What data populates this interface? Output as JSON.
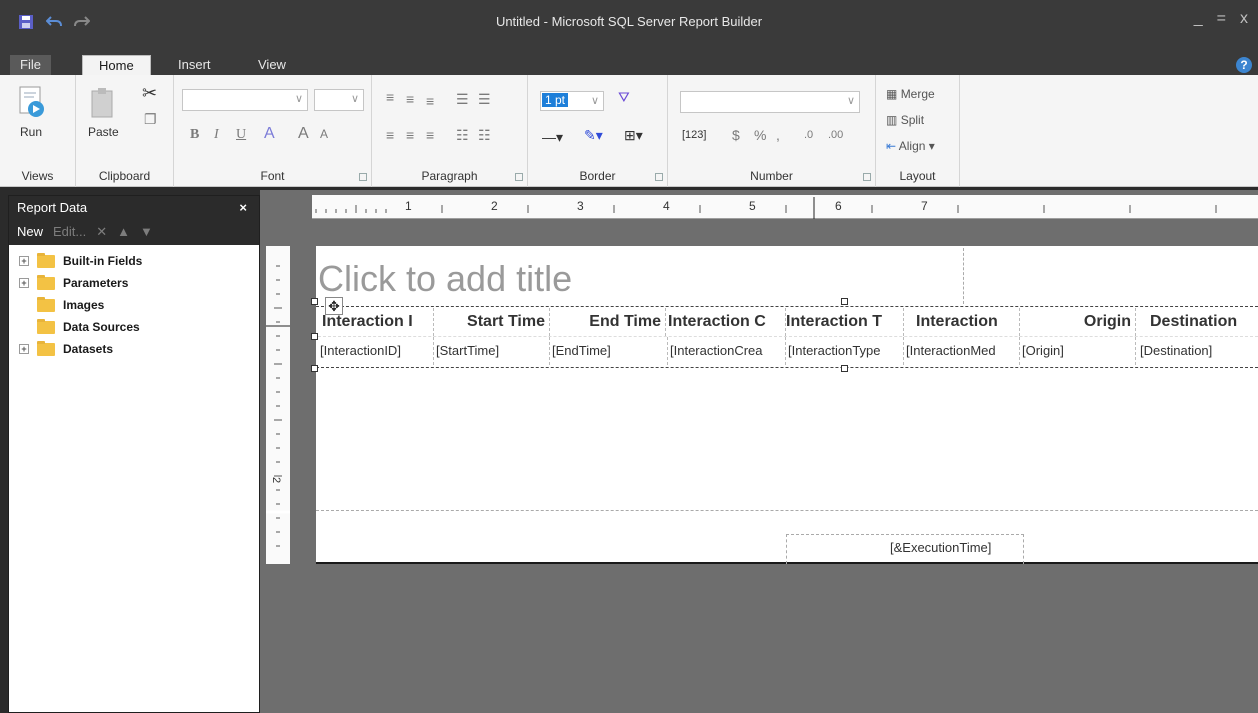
{
  "window": {
    "title": "Untitled - Microsoft SQL Server Report Builder",
    "controls": [
      "_",
      "=",
      "x"
    ]
  },
  "tabs": {
    "file": "File",
    "home": "Home",
    "insert": "Insert",
    "view": "View",
    "help": "?"
  },
  "ribbon": {
    "views": {
      "run": "Run",
      "label": "Views"
    },
    "clipboard": {
      "paste": "Paste",
      "label": "Clipboard"
    },
    "font": {
      "label": "Font",
      "bold": "B",
      "italic": "I",
      "underline": "U",
      "font_color": "A",
      "grow": "A",
      "shrink": "A"
    },
    "paragraph": {
      "label": "Paragraph"
    },
    "border": {
      "width_value": "1 pt",
      "label": "Border"
    },
    "number": {
      "label": "Number",
      "placeholder": "[123]",
      "currency": "$",
      "percent": "%",
      "comma": ",",
      "inc_dec": ".0",
      "dec_dec": ".00"
    },
    "layout": {
      "merge": "Merge",
      "split": "Split",
      "align": "Align",
      "label": "Layout"
    }
  },
  "report_data": {
    "title": "Report Data",
    "close": "×",
    "toolbar": {
      "new": "New",
      "edit": "Edit...",
      "delete": "✕",
      "up": "▲",
      "down": "▼"
    },
    "items": [
      {
        "label": "Built-in Fields",
        "expandable": true
      },
      {
        "label": "Parameters",
        "expandable": true
      },
      {
        "label": "Images",
        "expandable": false
      },
      {
        "label": "Data Sources",
        "expandable": false
      },
      {
        "label": "Datasets",
        "expandable": true
      }
    ]
  },
  "ruler": {
    "h_numbers": [
      "1",
      "2",
      "3",
      "4",
      "5",
      "6",
      "7"
    ],
    "v_number": "2"
  },
  "report": {
    "title_placeholder": "Click to add title",
    "headers": [
      "Interaction I",
      "Start Time",
      "End Time",
      "Interaction C",
      "Interaction T",
      "Interaction",
      "Origin",
      "Destination"
    ],
    "fields": [
      "[InteractionID]",
      "[StartTime]",
      "[EndTime]",
      "[InteractionCrea",
      "[InteractionType",
      "[InteractionMed",
      "[Origin]",
      "[Destination]"
    ],
    "footer_expression": "[&ExecutionTime]"
  }
}
